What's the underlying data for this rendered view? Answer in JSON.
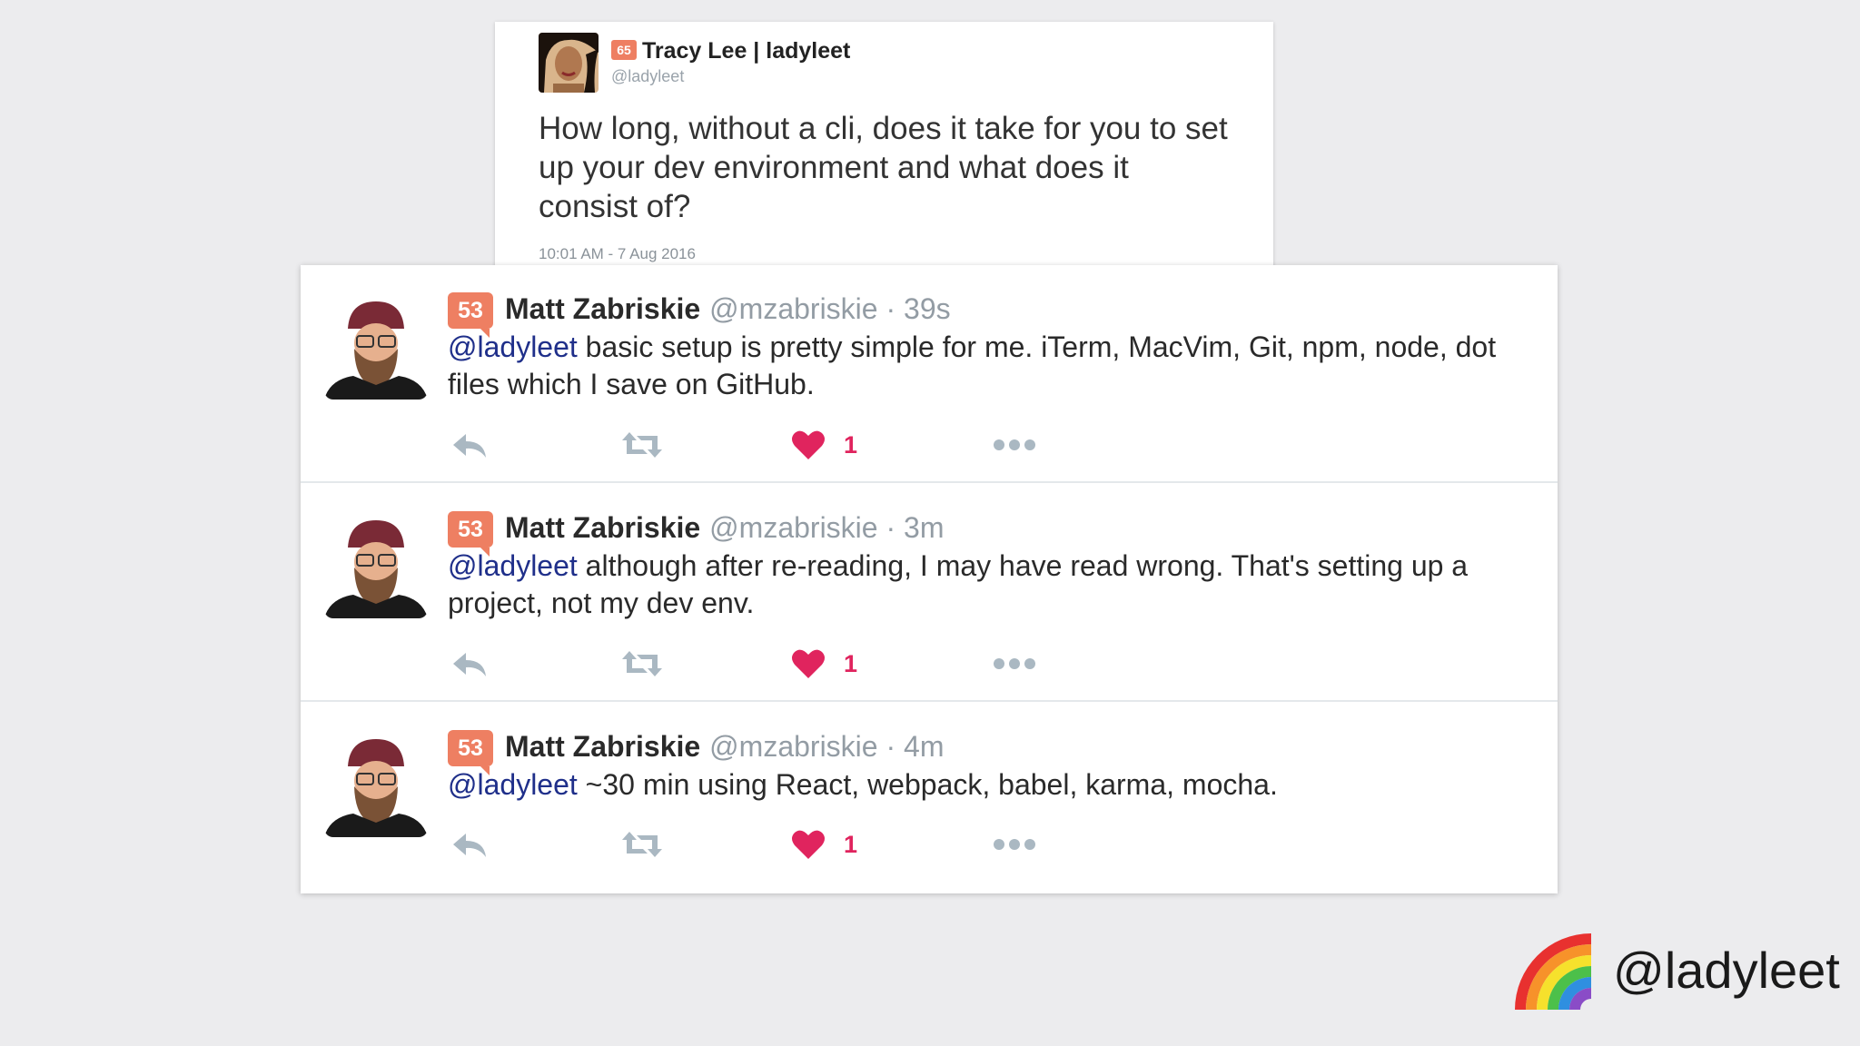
{
  "original_tweet": {
    "author_name": "Tracy Lee | ladyleet",
    "badge": "65",
    "handle": "@ladyleet",
    "text": "How long, without a cli, does it take for you to set up your dev environment and what does it consist of?",
    "timestamp": "10:01 AM - 7 Aug 2016"
  },
  "replies": [
    {
      "badge": "53",
      "author_name": "Matt Zabriskie",
      "meta": "@mzabriskie · 39s",
      "mention": "@ladyleet",
      "text": " basic setup is pretty simple for me. iTerm, MacVim, Git, npm, node, dot files which I save on GitHub.",
      "likes": "1"
    },
    {
      "badge": "53",
      "author_name": "Matt Zabriskie",
      "meta": "@mzabriskie · 3m",
      "mention": "@ladyleet",
      "text": " although after re-reading, I may have read wrong. That's setting up a project, not my dev env.",
      "likes": "1"
    },
    {
      "badge": "53",
      "author_name": "Matt Zabriskie",
      "meta": "@mzabriskie · 4m",
      "mention": "@ladyleet",
      "text": " ~30 min using React, webpack, babel, karma, mocha.",
      "likes": "1"
    }
  ],
  "icons": {
    "reply": "reply-icon",
    "retweet": "retweet-icon",
    "like": "heart-icon",
    "more": "more-icon",
    "brand": "rainbow-icon"
  },
  "colors": {
    "like": "#e0245e",
    "mention": "#1f2f8a",
    "badge": "#ee7f62",
    "muted": "#939ca4"
  },
  "brand": {
    "handle": "@ladyleet"
  }
}
